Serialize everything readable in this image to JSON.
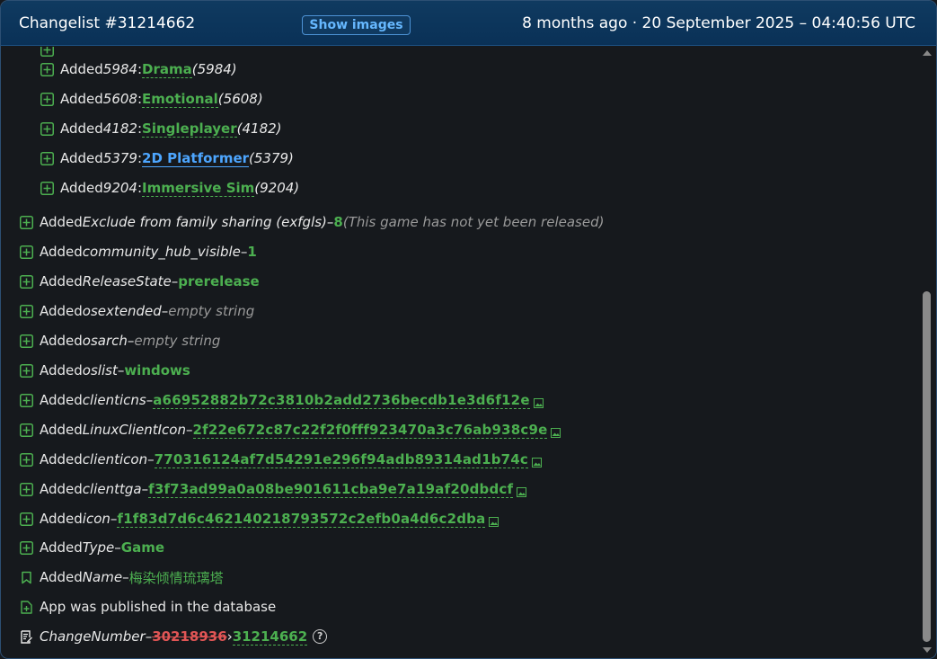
{
  "header": {
    "title": "Changelist #31214662",
    "show_images_label": "Show images",
    "date": "8 months ago · 20 September 2025 – 04:40:56 UTC"
  },
  "tags": [
    {
      "prefix": "Added ",
      "id": "5984",
      "sep": ": ",
      "name": "Drama",
      "suffix": " (5984)"
    },
    {
      "prefix": "Added ",
      "id": "5608",
      "sep": ": ",
      "name": "Emotional",
      "suffix": " (5608)"
    },
    {
      "prefix": "Added ",
      "id": "4182",
      "sep": ": ",
      "name": "Singleplayer",
      "suffix": " (4182)"
    },
    {
      "prefix": "Added ",
      "id": "5379",
      "sep": ": ",
      "name": "2D Platformer",
      "suffix": " (5379)"
    },
    {
      "prefix": "Added ",
      "id": "9204",
      "sep": ": ",
      "name": "Immersive Sim",
      "suffix": " (9204)"
    }
  ],
  "entries": [
    {
      "prefix": "Added ",
      "key": "Exclude from family sharing (exfgls)",
      "dash": " – ",
      "value": "8",
      "note": " (This game has not yet been released)"
    },
    {
      "prefix": "Added ",
      "key": "community_hub_visible",
      "dash": " – ",
      "value": "1"
    },
    {
      "prefix": "Added ",
      "key": "ReleaseState",
      "dash": " – ",
      "value": "prerelease"
    },
    {
      "prefix": "Added ",
      "key": "osextended",
      "dash": " – ",
      "empty": "empty string"
    },
    {
      "prefix": "Added ",
      "key": "osarch",
      "dash": " – ",
      "empty": "empty string"
    },
    {
      "prefix": "Added ",
      "key": "oslist",
      "dash": " – ",
      "value": "windows"
    },
    {
      "prefix": "Added ",
      "key": "clienticns",
      "dash": " – ",
      "hash": "a66952882b72c3810b2add2736becdb1e3d6f12e"
    },
    {
      "prefix": "Added ",
      "key": "LinuxClientIcon",
      "dash": " – ",
      "hash": "2f22e672c87c22f2f0fff923470a3c76ab938c9e"
    },
    {
      "prefix": "Added ",
      "key": "clienticon",
      "dash": " – ",
      "hash": "770316124af7d54291e296f94adb89314ad1b74c"
    },
    {
      "prefix": "Added ",
      "key": "clienttga",
      "dash": " – ",
      "hash": "f3f73ad99a0a08be901611cba9e7a19af20dbdcf"
    },
    {
      "prefix": "Added ",
      "key": "icon",
      "dash": " – ",
      "hash": "f1f83d7d6c462140218793572c2efb0a4d6c2dba"
    },
    {
      "prefix": "Added ",
      "key": "Type",
      "dash": " – ",
      "value": "Game"
    },
    {
      "prefix": "Added ",
      "key": "Name",
      "dash": " – ",
      "value": "梅染倾情琉璃塔"
    }
  ],
  "published": "App was published in the database",
  "change_number": {
    "key": "ChangeNumber",
    "dash": " – ",
    "old": "30218936",
    "arrow": " › ",
    "new": "31214662",
    "help": "?"
  },
  "colors": {
    "accent_green": "#4caf50",
    "link_blue": "#4da6ff",
    "removed_red": "#e05555",
    "header_bg": "#0b3359"
  }
}
